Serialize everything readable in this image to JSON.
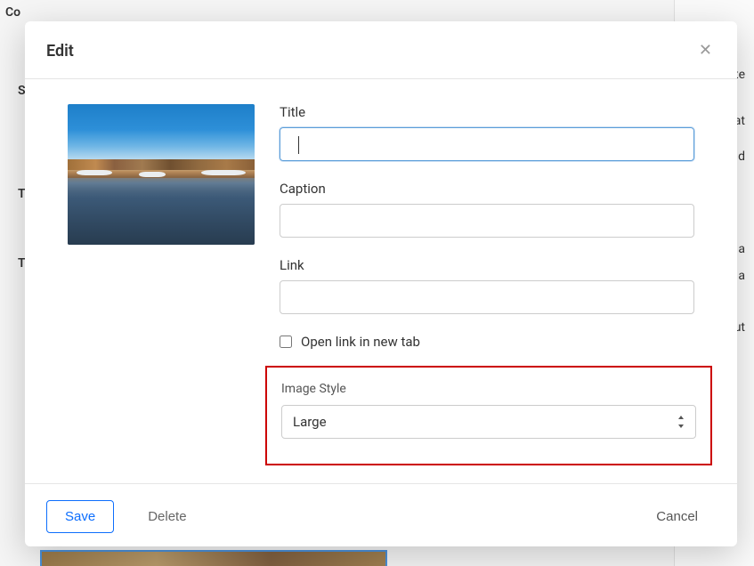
{
  "background": {
    "top_left_fragment": "Co",
    "left_items": [
      "S",
      "T",
      "T"
    ],
    "right_items": [
      "ate",
      "Dat",
      "d",
      "d a",
      "ed a",
      "out"
    ]
  },
  "modal": {
    "title": "Edit",
    "fields": {
      "title_label": "Title",
      "title_value": "",
      "caption_label": "Caption",
      "caption_value": "",
      "link_label": "Link",
      "link_value": "",
      "open_new_tab_label": "Open link in new tab",
      "open_new_tab_checked": false,
      "style_label": "Image Style",
      "style_value": "Large"
    },
    "footer": {
      "save": "Save",
      "delete": "Delete",
      "cancel": "Cancel"
    }
  }
}
